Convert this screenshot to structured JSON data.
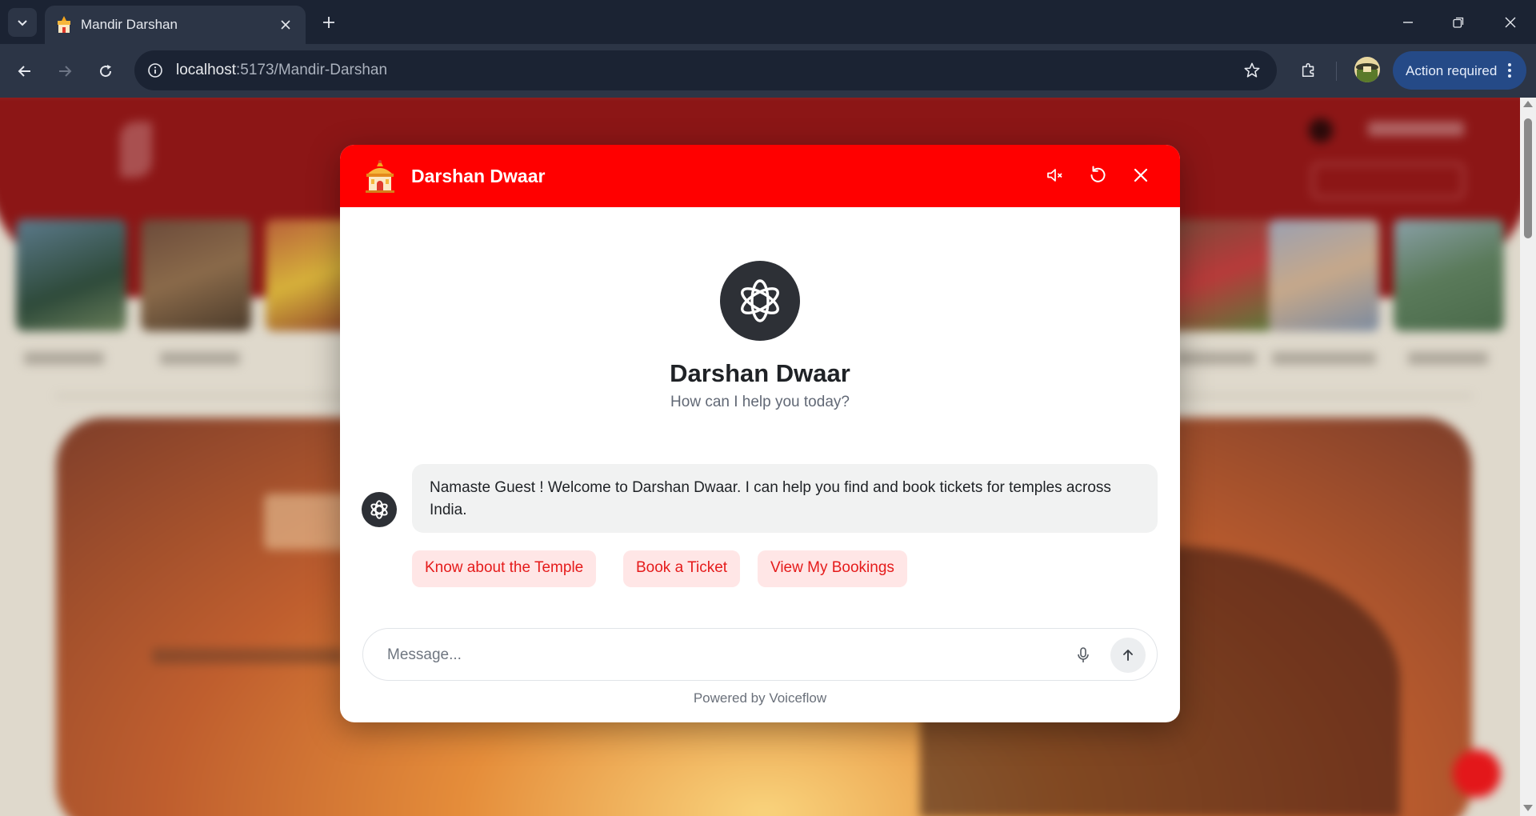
{
  "browser": {
    "tab_title": "Mandir Darshan",
    "url_host": "localhost",
    "url_path": ":5173/Mandir-Darshan",
    "action_label": "Action required"
  },
  "chat": {
    "header_title": "Darshan Dwaar",
    "bot_name": "Darshan Dwaar",
    "tagline": "How can I help you today?",
    "welcome_message": "Namaste Guest ! Welcome to Darshan Dwaar. I can help you find and book tickets for temples across India.",
    "quick_replies": [
      "Know about the Temple",
      "Book a Ticket",
      "View My Bookings"
    ],
    "input_placeholder": "Message...",
    "powered_by": "Powered by Voiceflow"
  },
  "colors": {
    "header_red": "#ff0000",
    "quick_reply_bg": "#ffe6e6",
    "quick_reply_text": "#e51b1b",
    "bot_avatar": "#2d3036",
    "browser_frame": "#1b2333",
    "browser_toolbar": "#2c3546",
    "action_pill": "#254a87"
  },
  "icons": {
    "header": [
      "mute-icon",
      "restart-icon",
      "close-icon"
    ],
    "composer": [
      "microphone-icon",
      "send-arrow-icon"
    ]
  }
}
